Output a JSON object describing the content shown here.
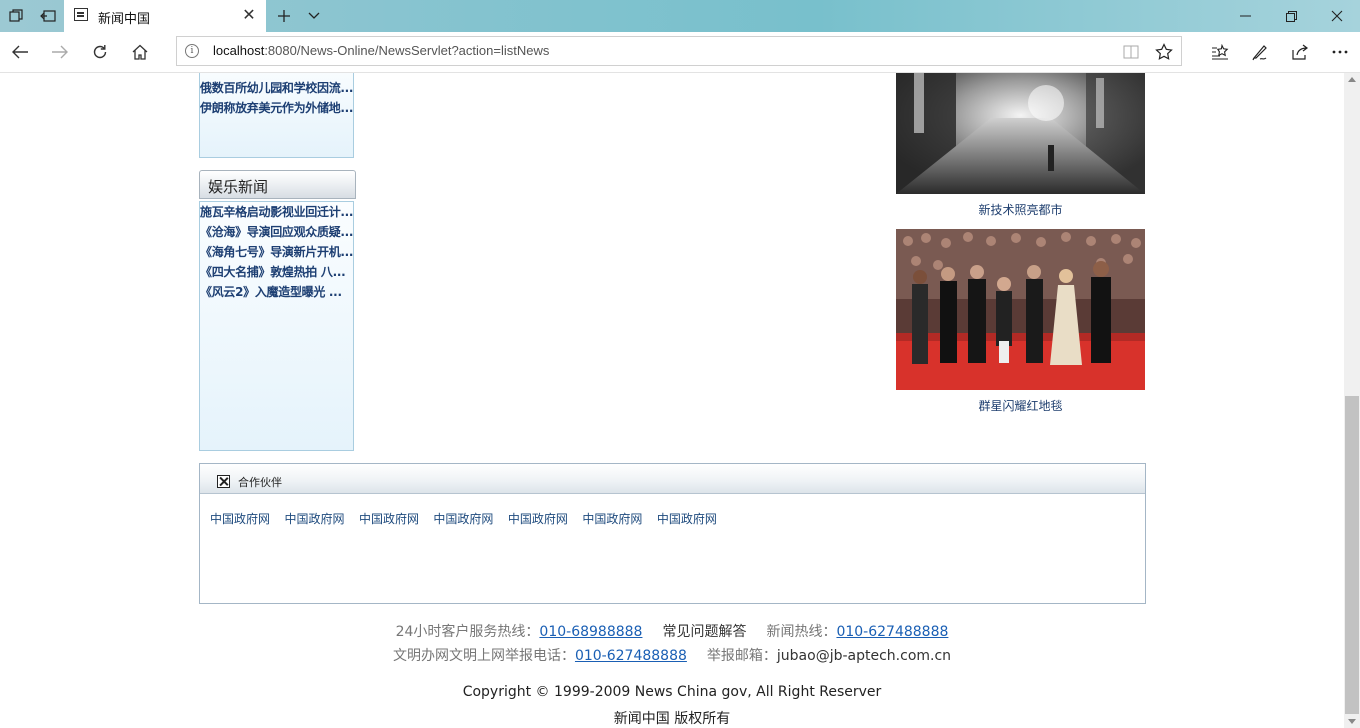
{
  "browser": {
    "tab_title": "新闻中国",
    "address_host": "localhost",
    "address_rest": ":8080/News-Online/NewsServlet?action=listNews"
  },
  "sidebar": {
    "intl_items": [
      "俄数百所幼儿园和学校因流...",
      "伊朗称放弃美元作为外储地..."
    ],
    "ent_title": "娱乐新闻",
    "ent_items": [
      "施瓦辛格启动影视业回迁计...",
      "《沧海》导演回应观众质疑...",
      "《海角七号》导演新片开机...",
      "《四大名捕》敦煌热拍 八...",
      "《风云2》入魔造型曝光 ..."
    ]
  },
  "photos": [
    {
      "caption": "新技术照亮都市"
    },
    {
      "caption": "群星闪耀红地毯"
    }
  ],
  "partners": {
    "title": "合作伙伴",
    "links": [
      "中国政府网",
      "中国政府网",
      "中国政府网",
      "中国政府网",
      "中国政府网",
      "中国政府网",
      "中国政府网"
    ]
  },
  "footer": {
    "hotline_label": "24小时客户服务热线：",
    "hotline_number": "010-68988888",
    "faq": "常见问题解答",
    "news_hotline_label": "新闻热线：",
    "news_hotline_number": "010-627488888",
    "report_label": "文明办网文明上网举报电话：",
    "report_number": "010-627488888",
    "email_label": "举报邮箱：",
    "email": "jubao@jb-aptech.com.cn",
    "copyright": "Copyright © 1999-2009 News China gov, All Right Reserver",
    "rights": "新闻中国 版权所有"
  }
}
